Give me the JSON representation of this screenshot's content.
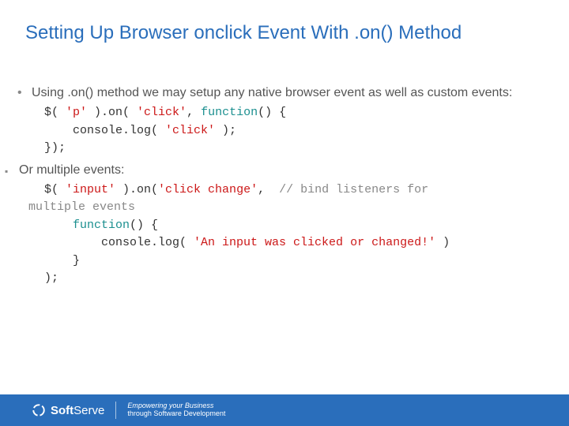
{
  "title": "Setting Up Browser onclick Event With .on() Method",
  "bullets": [
    {
      "text": "Using .on() method we may setup any native browser event as well as custom events:",
      "code": {
        "l1a": "$( ",
        "l1b": "'p'",
        "l1c": " ).on( ",
        "l1d": "'click'",
        "l1e": ", ",
        "l1f": "function",
        "l1g": "() {",
        "l2a": "    console.log( ",
        "l2b": "'click'",
        "l2c": " );",
        "l3": "});"
      }
    },
    {
      "text": "Or multiple events:",
      "code": {
        "l1a": "$( ",
        "l1b": "'input'",
        "l1c": " ).on(",
        "l1d": "'click change'",
        "l1e": ",  ",
        "l1f": "// bind listeners for",
        "l2": "multiple events",
        "l3a": "    ",
        "l3b": "function",
        "l3c": "() {",
        "l4a": "        console.log( ",
        "l4b": "'An input was clicked or changed!'",
        "l4c": " )",
        "l5": "    }",
        "l6": ");"
      }
    }
  ],
  "footer": {
    "brand1": "Soft",
    "brand2": "Serve",
    "tag1": "Empowering your Business",
    "tag2": "through Software Development"
  }
}
